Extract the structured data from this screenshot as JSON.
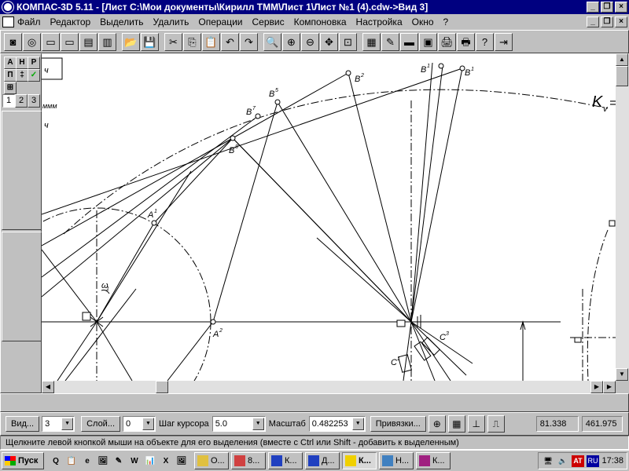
{
  "window": {
    "title": "КОМПАС-3D 5.11 - [Лист C:\\Мои документы\\Кирилл ТММ\\Лист 1\\Лист №1 (4).cdw->Вид 3]",
    "btn_minimize": "_",
    "btn_restore": "❐",
    "btn_close": "×"
  },
  "menu": [
    "Файл",
    "Редактор",
    "Выделить",
    "Удалить",
    "Операции",
    "Сервис",
    "Компоновка",
    "Настройка",
    "Окно",
    "?"
  ],
  "toolbar_icons": [
    "new-sheet-icon",
    "new-fragment-icon",
    "new-document-icon",
    "new-text-doc-icon",
    "new-spec-icon",
    "new-model-icon",
    "open-folder-icon",
    "save-icon",
    "cut-icon",
    "copy-icon",
    "paste-icon",
    "undo-icon",
    "redo-icon",
    "zoom-window-icon",
    "zoom-in-icon",
    "zoom-out-icon",
    "pan-icon",
    "zoom-all-icon",
    "grid-icon",
    "pencil-icon",
    "layer-icon",
    "monitor-icon",
    "print-preview-icon",
    "print-icon",
    "help-icon",
    "exit-icon"
  ],
  "toolbar_glyphs": [
    "◙",
    "◎",
    "▭",
    "▭",
    "▤",
    "▥",
    "📂",
    "💾",
    "✂",
    "⎘",
    "📋",
    "↶",
    "↷",
    "🔍",
    "⊕",
    "⊖",
    "✥",
    "⊡",
    "▦",
    "✎",
    "▬",
    "▣",
    "🖨",
    "🖶",
    "?",
    "⇥"
  ],
  "left_panel": {
    "row1": [
      "А",
      "Н",
      "Р"
    ],
    "row2": [
      "П",
      "‡",
      "✓"
    ],
    "row3": [
      "⊞"
    ],
    "tabs": [
      "1",
      "2",
      "3"
    ]
  },
  "drawing": {
    "labels": {
      "top_left_box": "ч",
      "mm": "ммм",
      "ch": "ч",
      "kv": "K",
      "kv_sub": "v",
      "kv_eq": "=",
      "b1": "B",
      "b2": "B",
      "b3": "B",
      "b4": "B",
      "b5": "B",
      "b6": "B",
      "b7": "B",
      "a1": "A",
      "a2": "A",
      "omega": "ω",
      "c1": "C",
      "c2": "C",
      "sup1": "1",
      "sup2": "2",
      "sup3": "3",
      "sup5": "5",
      "sup7": "7",
      "sup8": "8",
      "sup6": "6"
    }
  },
  "statusbar": {
    "view_btn": "Вид...",
    "view_value": "3",
    "layer_btn": "Слой...",
    "layer_value": "0",
    "step_label": "Шаг курсора",
    "step_value": "5.0",
    "scale_label": "Масштаб",
    "scale_value": "0.482253",
    "snaps_btn": "Привязки...",
    "coord_x": "81.338",
    "coord_y": "461.975"
  },
  "hint": "Щелкните левой кнопкой мыши на объекте для его выделения (вместе с Ctrl или Shift - добавить к выделенным)",
  "taskbar": {
    "start": "Пуск",
    "quicklaunch": [
      "Q",
      "📋",
      "e",
      "🖼",
      "✎",
      "W",
      "📊",
      "X",
      "🖼"
    ],
    "tasks": [
      {
        "icon": "folder",
        "label": "О..."
      },
      {
        "icon": "pencil",
        "label": "8..."
      },
      {
        "icon": "word",
        "label": "К..."
      },
      {
        "icon": "word",
        "label": "Д..."
      },
      {
        "icon": "kompas",
        "label": "К...",
        "active": true
      },
      {
        "icon": "q",
        "label": "Н..."
      },
      {
        "icon": "book",
        "label": "К..."
      }
    ],
    "tray_icons": [
      "🖥",
      "🔈",
      "AT",
      "RU"
    ],
    "clock": "17:38"
  }
}
